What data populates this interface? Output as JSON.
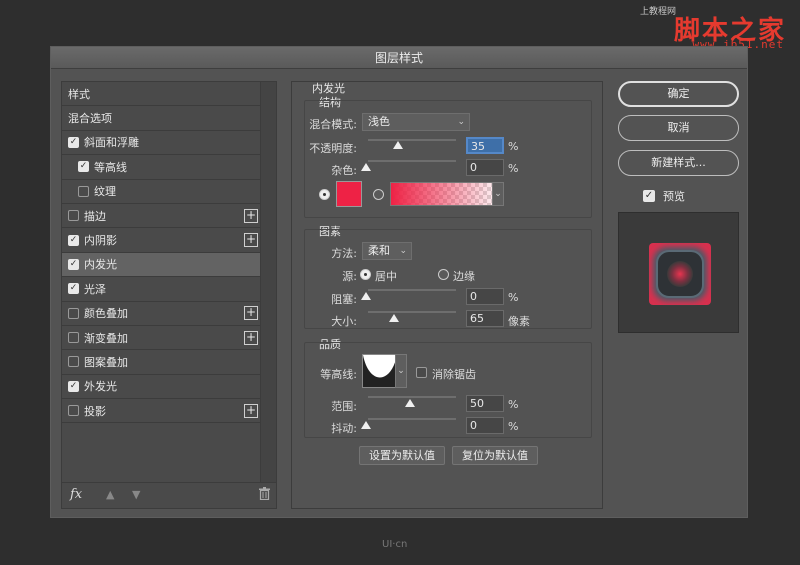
{
  "watermark": {
    "small": "上教程网",
    "big": "脚本之家",
    "url": "www.jb51.net",
    "bottom": "UI·cn"
  },
  "dialog": {
    "title": "图层样式"
  },
  "styles_list": [
    {
      "label": "样式",
      "checkbox": null,
      "indent": false,
      "plus": false,
      "selected": false
    },
    {
      "label": "混合选项",
      "checkbox": null,
      "indent": false,
      "plus": false,
      "selected": false
    },
    {
      "label": "斜面和浮雕",
      "checkbox": true,
      "indent": false,
      "plus": false,
      "selected": false
    },
    {
      "label": "等高线",
      "checkbox": true,
      "indent": true,
      "plus": false,
      "selected": false
    },
    {
      "label": "纹理",
      "checkbox": false,
      "indent": true,
      "plus": false,
      "selected": false
    },
    {
      "label": "描边",
      "checkbox": false,
      "indent": false,
      "plus": true,
      "selected": false
    },
    {
      "label": "内阴影",
      "checkbox": true,
      "indent": false,
      "plus": true,
      "selected": false
    },
    {
      "label": "内发光",
      "checkbox": true,
      "indent": false,
      "plus": false,
      "selected": true
    },
    {
      "label": "光泽",
      "checkbox": true,
      "indent": false,
      "plus": false,
      "selected": false
    },
    {
      "label": "颜色叠加",
      "checkbox": false,
      "indent": false,
      "plus": true,
      "selected": false
    },
    {
      "label": "渐变叠加",
      "checkbox": false,
      "indent": false,
      "plus": true,
      "selected": false
    },
    {
      "label": "图案叠加",
      "checkbox": false,
      "indent": false,
      "plus": false,
      "selected": false
    },
    {
      "label": "外发光",
      "checkbox": true,
      "indent": false,
      "plus": false,
      "selected": false
    },
    {
      "label": "投影",
      "checkbox": false,
      "indent": false,
      "plus": true,
      "selected": false
    }
  ],
  "footer": {
    "fx": "fx"
  },
  "inner_glow": {
    "title": "内发光",
    "structure": {
      "title": "结构",
      "blend_mode_label": "混合模式:",
      "blend_mode_value": "浅色",
      "opacity_label": "不透明度:",
      "opacity_value": "35",
      "noise_label": "杂色:",
      "noise_value": "0",
      "percent": "%",
      "color": "#ee2245"
    },
    "elements": {
      "title": "图素",
      "technique_label": "方法:",
      "technique_value": "柔和",
      "source_label": "源:",
      "source_center": "居中",
      "source_edge": "边缘",
      "choke_label": "阻塞:",
      "choke_value": "0",
      "size_label": "大小:",
      "size_value": "65",
      "size_unit": "像素",
      "percent": "%"
    },
    "quality": {
      "title": "品质",
      "contour_label": "等高线:",
      "antialias_label": "消除锯齿",
      "range_label": "范围:",
      "range_value": "50",
      "jitter_label": "抖动:",
      "jitter_value": "0",
      "percent": "%"
    },
    "make_default": "设置为默认值",
    "reset_default": "复位为默认值"
  },
  "buttons": {
    "ok": "确定",
    "cancel": "取消",
    "new_style": "新建样式...",
    "preview": "预览"
  }
}
